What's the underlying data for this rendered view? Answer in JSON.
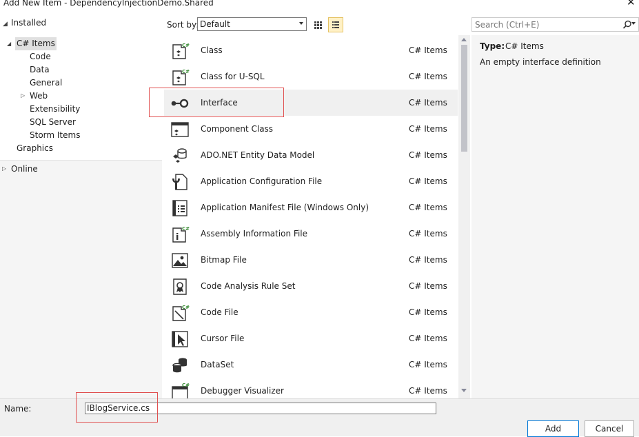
{
  "window": {
    "title": "Add New Item - DependencyInjectionDemo.Shared",
    "close_glyph": "✕"
  },
  "tree": {
    "installed": "Installed",
    "items": [
      {
        "label": "C# Items",
        "selected": true
      },
      {
        "label": "Code"
      },
      {
        "label": "Data"
      },
      {
        "label": "General"
      },
      {
        "label": "Web"
      },
      {
        "label": "Extensibility"
      },
      {
        "label": "SQL Server"
      },
      {
        "label": "Storm Items"
      },
      {
        "label": "Graphics"
      }
    ],
    "online": "Online"
  },
  "toolbar": {
    "sort_label": "Sort by:",
    "sort_value": "Default"
  },
  "search": {
    "placeholder": "Search (Ctrl+E)"
  },
  "templates": [
    {
      "name": "Class",
      "category": "C# Items",
      "icon": "class-icon"
    },
    {
      "name": "Class for U-SQL",
      "category": "C# Items",
      "icon": "usql-class-icon"
    },
    {
      "name": "Interface",
      "category": "C# Items",
      "icon": "interface-icon",
      "selected": true
    },
    {
      "name": "Component Class",
      "category": "C# Items",
      "icon": "component-class-icon"
    },
    {
      "name": "ADO.NET Entity Data Model",
      "category": "C# Items",
      "icon": "entity-model-icon"
    },
    {
      "name": "Application Configuration File",
      "category": "C# Items",
      "icon": "config-file-icon"
    },
    {
      "name": "Application Manifest File (Windows Only)",
      "category": "C# Items",
      "icon": "manifest-file-icon"
    },
    {
      "name": "Assembly Information File",
      "category": "C# Items",
      "icon": "assembly-info-icon"
    },
    {
      "name": "Bitmap File",
      "category": "C# Items",
      "icon": "bitmap-icon"
    },
    {
      "name": "Code Analysis Rule Set",
      "category": "C# Items",
      "icon": "rule-set-icon"
    },
    {
      "name": "Code File",
      "category": "C# Items",
      "icon": "code-file-icon"
    },
    {
      "name": "Cursor File",
      "category": "C# Items",
      "icon": "cursor-file-icon"
    },
    {
      "name": "DataSet",
      "category": "C# Items",
      "icon": "dataset-icon"
    },
    {
      "name": "Debugger Visualizer",
      "category": "C# Items",
      "icon": "debugger-visualizer-icon"
    }
  ],
  "details": {
    "type_label": "Type:",
    "type_value": "C# Items",
    "description": "An empty interface definition"
  },
  "name_field": {
    "label": "Name:",
    "value": "IBlogService.cs"
  },
  "buttons": {
    "add": "Add",
    "cancel": "Cancel"
  },
  "colors": {
    "selection": "#f0f0f0",
    "highlight_box": "#e05050",
    "accent": "#0078d7"
  }
}
